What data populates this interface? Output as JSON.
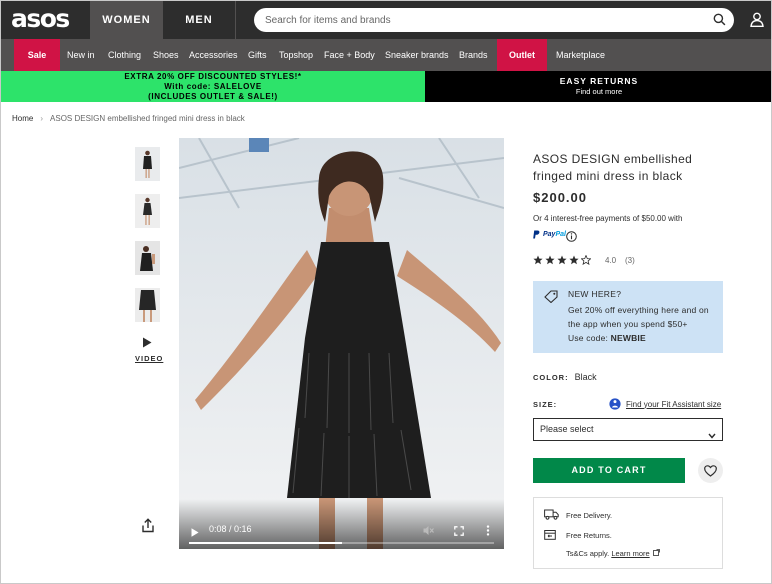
{
  "header": {
    "logo": "asos",
    "tabs": [
      "WOMEN",
      "MEN"
    ],
    "search_placeholder": "Search for items and brands"
  },
  "nav": {
    "categories": [
      "Sale",
      "New in",
      "Clothing",
      "Shoes",
      "Accessories",
      "Gifts",
      "Topshop",
      "Face + Body",
      "Sneaker brands",
      "Brands",
      "Outlet",
      "Marketplace"
    ]
  },
  "banners": {
    "left_line1": "EXTRA 20% OFF DISCOUNTED STYLES!*",
    "left_line2": "With code: SALELOVE",
    "left_line3": "(INCLUDES OUTLET & SALE!)",
    "right_title": "EASY RETURNS",
    "right_sub": "Find out more"
  },
  "breadcrumb": {
    "home": "Home",
    "current": "ASOS DESIGN embellished fringed mini dress in black"
  },
  "gallery": {
    "video_label": "VIDEO",
    "video_time": "0:08 / 0:16",
    "video_progress": 0.5
  },
  "product": {
    "title": "ASOS DESIGN embellished fringed mini dress in black",
    "price": "$200.00",
    "installments": "Or 4 interest-free payments of $50.00 with",
    "paypal_a": "Pay",
    "paypal_b": "Pal",
    "rating": "4.0",
    "reviews": "(3)",
    "stars_filled": 4,
    "promo_head": "NEW HERE?",
    "promo_body": "Get 20% off everything here and on the app when you spend $50+",
    "promo_code_label": "Use code:",
    "promo_code": "NEWBIE",
    "color_label": "COLOR:",
    "color_value": "Black",
    "size_label": "SIZE:",
    "fit_link": "Find your Fit Assistant size",
    "size_placeholder": "Please select",
    "add_to_cart": "ADD TO CART",
    "delivery_free": "Free Delivery.",
    "returns_free": "Free Returns.",
    "terms": "Ts&Cs apply.",
    "learn_more": "Learn more"
  },
  "colors": {
    "header_bg": "#2d2d2d",
    "nav_bg": "#525050",
    "sale_pill": "#d01345",
    "promo_green": "#2de36a",
    "cart_green": "#018849",
    "promo_box": "#cde2f5"
  }
}
